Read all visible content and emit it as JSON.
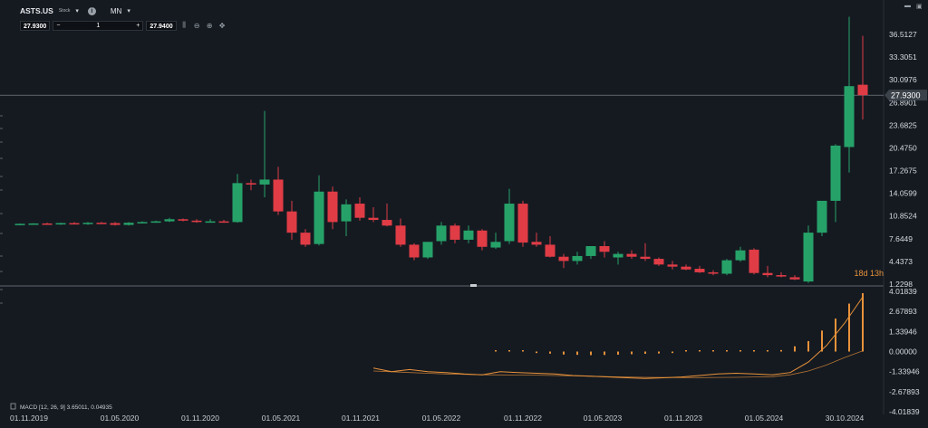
{
  "toolbar": {
    "symbol": "ASTS.US",
    "symbol_type": "Stock",
    "timeframe": "MN",
    "bid": "27.9300",
    "ask": "27.9400",
    "quantity": "1",
    "minus": "−",
    "plus": "+",
    "tools": [
      "chart-bars-icon",
      "zoom-out-icon",
      "zoom-in-icon",
      "crosshair-icon"
    ]
  },
  "timer": "18d 13h",
  "colors": {
    "up": "#26a269",
    "down": "#e03c46",
    "macd": "#e8923a",
    "bg": "#151a21"
  },
  "chart_data": [
    {
      "type": "candlestick",
      "price_labels": [
        "36.5127",
        "33.3051",
        "30.0976",
        "26.8901",
        "23.6825",
        "20.4750",
        "17.2675",
        "14.0599",
        "10.8524",
        "7.6449",
        "4.4373",
        "1.2298"
      ],
      "current_price": "27.9300",
      "x_labels": [
        "01.11.2019",
        "01.05.2020",
        "01.11.2020",
        "01.05.2021",
        "01.11.2021",
        "01.05.2022",
        "01.11.2022",
        "01.05.2023",
        "01.11.2023",
        "01.05.2024",
        "30.10.2024"
      ],
      "ohlc": [
        [
          9.7,
          9.8,
          9.6,
          9.75
        ],
        [
          9.75,
          9.85,
          9.7,
          9.8
        ],
        [
          9.8,
          9.9,
          9.7,
          9.72
        ],
        [
          9.72,
          9.9,
          9.6,
          9.85
        ],
        [
          9.85,
          10.0,
          9.7,
          9.8
        ],
        [
          9.8,
          10.0,
          9.6,
          9.9
        ],
        [
          9.9,
          10.0,
          9.8,
          9.85
        ],
        [
          9.85,
          10.0,
          9.5,
          9.6
        ],
        [
          9.6,
          10.0,
          9.5,
          9.9
        ],
        [
          9.9,
          10.1,
          9.8,
          10.0
        ],
        [
          10.0,
          10.2,
          9.9,
          10.1
        ],
        [
          10.1,
          10.6,
          10.0,
          10.4
        ],
        [
          10.4,
          10.5,
          10.1,
          10.2
        ],
        [
          10.2,
          10.4,
          9.9,
          10.0
        ],
        [
          10.0,
          10.4,
          9.9,
          10.1
        ],
        [
          10.1,
          10.3,
          9.9,
          10.05
        ],
        [
          10.0,
          16.8,
          9.9,
          15.5
        ],
        [
          15.5,
          16.0,
          14.5,
          15.3
        ],
        [
          15.3,
          25.7,
          13.5,
          16.0
        ],
        [
          16.0,
          17.8,
          11.0,
          11.5
        ],
        [
          11.5,
          13.0,
          7.5,
          8.5
        ],
        [
          8.5,
          9.0,
          6.5,
          6.8
        ],
        [
          6.9,
          16.6,
          6.7,
          14.3
        ],
        [
          14.3,
          15.0,
          9.0,
          10.0
        ],
        [
          10.1,
          13.2,
          8.0,
          12.5
        ],
        [
          12.6,
          13.5,
          10.2,
          10.6
        ],
        [
          10.6,
          12.1,
          10.0,
          10.3
        ],
        [
          10.3,
          12.6,
          9.4,
          9.5
        ],
        [
          9.5,
          10.5,
          6.5,
          6.8
        ],
        [
          6.8,
          7.0,
          4.6,
          5.0
        ],
        [
          5.0,
          7.0,
          4.8,
          7.2
        ],
        [
          7.3,
          10.0,
          6.8,
          9.5
        ],
        [
          9.5,
          9.8,
          7.0,
          7.5
        ],
        [
          7.5,
          9.5,
          7.0,
          8.8
        ],
        [
          8.8,
          9.0,
          6.0,
          6.5
        ],
        [
          6.4,
          8.5,
          6.2,
          7.2
        ],
        [
          7.3,
          14.7,
          6.9,
          12.6
        ],
        [
          12.6,
          13.0,
          6.5,
          7.1
        ],
        [
          7.2,
          8.5,
          6.5,
          6.8
        ],
        [
          6.8,
          8.0,
          5.0,
          5.1
        ],
        [
          5.1,
          5.5,
          3.5,
          4.5
        ],
        [
          4.5,
          5.8,
          4.0,
          5.2
        ],
        [
          5.2,
          6.0,
          4.8,
          6.6
        ],
        [
          6.6,
          7.3,
          5.0,
          5.8
        ],
        [
          5.0,
          5.8,
          4.0,
          5.5
        ],
        [
          5.5,
          6.0,
          4.8,
          5.1
        ],
        [
          5.1,
          7.0,
          4.5,
          4.8
        ],
        [
          4.8,
          5.0,
          3.8,
          4.0
        ],
        [
          4.0,
          4.5,
          3.3,
          3.7
        ],
        [
          3.7,
          4.0,
          3.2,
          3.3
        ],
        [
          3.4,
          3.8,
          2.8,
          2.9
        ],
        [
          2.9,
          3.2,
          2.5,
          2.7
        ],
        [
          2.7,
          4.8,
          2.5,
          4.6
        ],
        [
          4.6,
          6.5,
          4.4,
          6.0
        ],
        [
          6.1,
          6.3,
          2.6,
          2.8
        ],
        [
          2.8,
          3.8,
          2.2,
          2.5
        ],
        [
          2.5,
          2.9,
          2.2,
          2.3
        ],
        [
          2.2,
          2.5,
          1.8,
          1.9
        ],
        [
          1.6,
          9.5,
          1.4,
          8.5
        ],
        [
          8.5,
          12.5,
          8.0,
          13.0
        ],
        [
          13.0,
          21.0,
          10.0,
          20.8
        ],
        [
          20.6,
          39.0,
          17.0,
          29.2
        ],
        [
          29.4,
          36.3,
          24.5,
          27.93
        ]
      ],
      "macd_labels": [
        "4.01839",
        "2.67893",
        "1.33946",
        "0.00000",
        "-1.33946",
        "-2.67893",
        "-4.01839"
      ],
      "macd_legend": "MACD [12, 26, 9] 3.65011, 0.04935",
      "histogram": [
        0.02,
        -0.03,
        -0.06,
        -0.1,
        -0.14,
        -0.2,
        -0.22,
        -0.24,
        -0.23,
        -0.21,
        -0.18,
        -0.15,
        -0.13,
        -0.1,
        -0.08,
        -0.05,
        -0.02,
        0.01,
        0.02,
        -0.03,
        0.02,
        0.1,
        0.35,
        0.7,
        1.4,
        2.2,
        3.2,
        3.9
      ],
      "macd_line": [
        -1.1,
        -1.35,
        -1.2,
        -1.35,
        -1.4,
        -1.5,
        -1.55,
        -1.35,
        -1.4,
        -1.45,
        -1.5,
        -1.6,
        -1.65,
        -1.7,
        -1.75,
        -1.8,
        -1.75,
        -1.7,
        -1.6,
        -1.5,
        -1.45,
        -1.5,
        -1.55,
        -1.4,
        -0.7,
        0.4,
        1.9,
        3.65
      ],
      "signal_line": [
        -1.3,
        -1.35,
        -1.4,
        -1.45,
        -1.5,
        -1.52,
        -1.55,
        -1.56,
        -1.57,
        -1.58,
        -1.6,
        -1.62,
        -1.65,
        -1.68,
        -1.7,
        -1.72,
        -1.73,
        -1.74,
        -1.74,
        -1.73,
        -1.72,
        -1.7,
        -1.68,
        -1.55,
        -1.3,
        -0.9,
        -0.4,
        0.05
      ]
    }
  ]
}
